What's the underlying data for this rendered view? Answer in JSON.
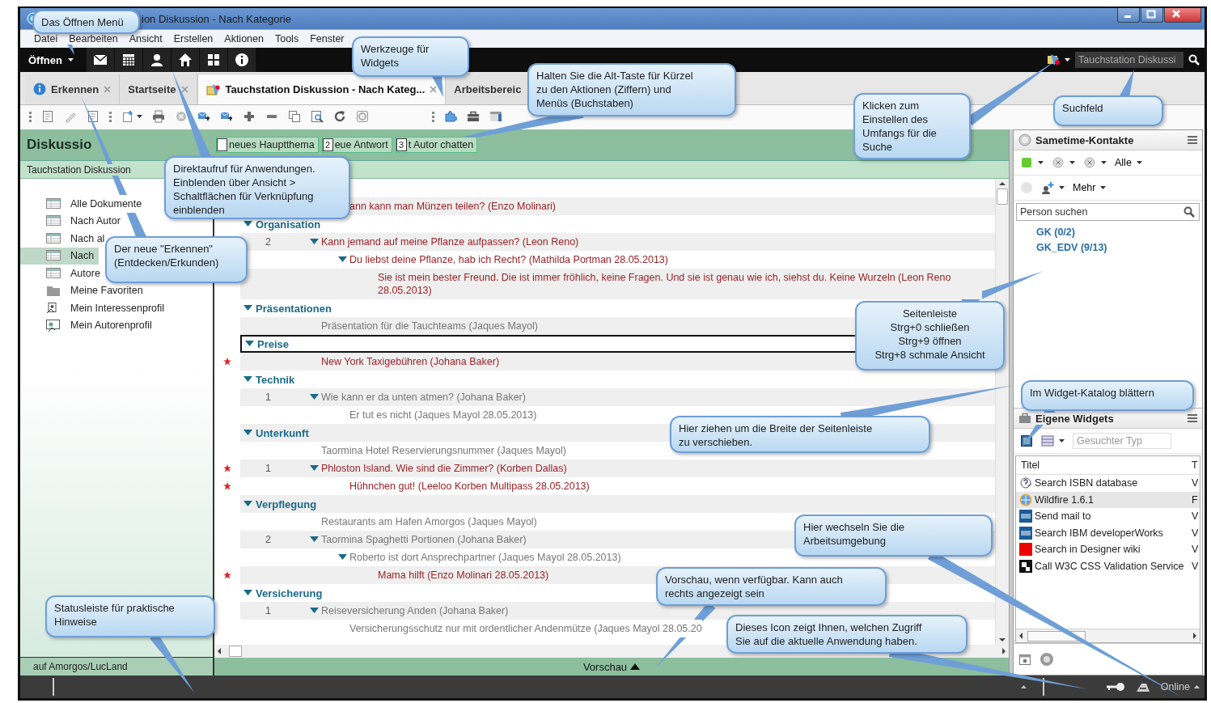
{
  "window": {
    "title": "ion Diskussion - Nach Kategorie"
  },
  "menu": [
    "Datei",
    "Bearbeiten",
    "Ansicht",
    "Erstellen",
    "Aktionen",
    "Tools",
    "Fenster"
  ],
  "launcher": {
    "open_label": "Öffnen",
    "search": {
      "placeholder": "Tauchstation Diskussi"
    }
  },
  "tabs": [
    {
      "label": "Erkennen",
      "selected": false,
      "closable": true,
      "kind": "info"
    },
    {
      "label": "Startseite",
      "selected": false,
      "closable": true,
      "kind": "plain"
    },
    {
      "label": "Tauchstation Diskussion - Nach Kateg...",
      "selected": true,
      "closable": true,
      "kind": "app"
    },
    {
      "label": "Arbeitsbereic",
      "selected": false,
      "closable": false,
      "kind": "plain"
    }
  ],
  "view": {
    "title": "Diskussio",
    "database": "Tauchstation Diskussion",
    "actions": [
      {
        "label": "neues Hauptthema"
      },
      {
        "key": "2",
        "label": "eue Antwort"
      },
      {
        "key": "3",
        "label": "t Autor chatten"
      }
    ]
  },
  "navigation": [
    {
      "label": "Alle Dokumente",
      "kind": "view",
      "selected": false
    },
    {
      "label": "Nach Autor",
      "kind": "view",
      "selected": false
    },
    {
      "label": "Nach al",
      "kind": "view",
      "selected": false
    },
    {
      "label": "Nach",
      "kind": "view",
      "selected": true
    },
    {
      "label": "Autore",
      "kind": "view",
      "selected": false
    },
    {
      "label": "Meine Favoriten",
      "kind": "folder",
      "selected": false
    },
    {
      "label": "Mein Interessenprofil",
      "kind": "profile",
      "selected": false
    },
    {
      "label": "Mein Autorenprofil",
      "kind": "author",
      "selected": false
    }
  ],
  "server": "auf Amorgos/LucLand",
  "rows": [
    {
      "kind": "entry",
      "label": "ann kann man Münzen teilen? (Enzo Molinari)",
      "unread": true
    },
    {
      "kind": "category",
      "label": "Organisation",
      "selected": false,
      "expanded": true,
      "children": [
        {
          "kind": "entry",
          "count": "2",
          "label": "Kann jemand auf meine Pflanze aufpassen? (Leon Reno)",
          "unread": true,
          "starred": false,
          "expanded": true,
          "children": [
            {
              "kind": "entry",
              "label": "Du liebst deine Pflanze, hab ich Recht?  (Mathilda Portman 28.05.2013)",
              "unread": true,
              "starred": false,
              "expanded": true,
              "children": [
                {
                  "kind": "entry",
                  "label": "Sie ist mein bester Freund. Die ist immer fröhlich, keine Fragen. Und sie ist genau wie ich, siehst du. Keine Wurzeln  (Leon Reno 28.05.2013)",
                  "unread": true,
                  "starred": false
                }
              ]
            }
          ]
        }
      ]
    },
    {
      "kind": "category",
      "label": "Präsentationen",
      "selected": false,
      "expanded": true,
      "children": [
        {
          "kind": "entry",
          "label": "Präsentation für die Tauchteams (Jaques Mayol)",
          "unread": false,
          "starred": false
        }
      ]
    },
    {
      "kind": "category",
      "label": "Preise",
      "selected": true,
      "expanded": true,
      "children": [
        {
          "kind": "entry",
          "label": "New York Taxigebühren (Johana Baker)",
          "unread": true,
          "starred": true
        }
      ]
    },
    {
      "kind": "category",
      "label": "Technik",
      "selected": false,
      "expanded": true,
      "children": [
        {
          "kind": "entry",
          "count": "1",
          "label": "Wie kann er da unten atmen? (Johana Baker)",
          "unread": false,
          "starred": false,
          "expanded": true,
          "children": [
            {
              "kind": "entry",
              "label": "Er tut es nicht  (Jaques Mayol 28.05.2013)",
              "unread": false,
              "starred": false
            }
          ]
        }
      ]
    },
    {
      "kind": "category",
      "label": "Unterkunft",
      "selected": false,
      "expanded": true,
      "children": [
        {
          "kind": "entry",
          "label": "Taormina Hotel Reservierungsnummer (Jaques Mayol)",
          "unread": false,
          "starred": false
        },
        {
          "kind": "entry",
          "count": "1",
          "label": "Phloston Island. Wie sind die Zimmer? (Korben Dallas)",
          "unread": true,
          "starred": true,
          "expanded": true,
          "children": [
            {
              "kind": "entry",
              "label": "Hühnchen gut!  (Leeloo Korben Multipass 28.05.2013)",
              "unread": true,
              "starred": true
            }
          ]
        }
      ]
    },
    {
      "kind": "category",
      "label": "Verpflegung",
      "selected": false,
      "expanded": true,
      "children": [
        {
          "kind": "entry",
          "label": "Restaurants am Hafen Amorgos (Jaques Mayol)",
          "unread": false,
          "starred": false
        },
        {
          "kind": "entry",
          "count": "2",
          "label": "Taormina Spaghetti Portionen (Johana Baker)",
          "unread": false,
          "starred": false,
          "expanded": true,
          "children": [
            {
              "kind": "entry",
              "label": "Roberto ist dort Ansprechpartner  (Jaques Mayol 28.05.2013)",
              "unread": false,
              "starred": false,
              "expanded": true,
              "children": [
                {
                  "kind": "entry",
                  "label": "Mama hilft  (Enzo Molinari 28.05.2013)",
                  "unread": true,
                  "starred": true
                }
              ]
            }
          ]
        }
      ]
    },
    {
      "kind": "category",
      "label": "Versicherung",
      "selected": false,
      "expanded": true,
      "children": [
        {
          "kind": "entry",
          "count": "1",
          "label": "Reiseversicherung Anden (Johana Baker)",
          "unread": false,
          "starred": false,
          "expanded": true,
          "children": [
            {
              "kind": "entry",
              "label": "Versicherungsschutz nur mit ordentlicher Andenmütze  (Jaques Mayol 28.05.20",
              "unread": false,
              "starred": false
            }
          ]
        }
      ]
    }
  ],
  "preview": {
    "label": "Vorschau"
  },
  "sidebar": {
    "contacts": {
      "title": "Sametime-Kontakte",
      "filter": "Alle",
      "more": "Mehr",
      "search": {
        "placeholder": "Person suchen"
      },
      "groups": [
        "GK (0/2)",
        "GK_EDV (9/13)"
      ]
    },
    "widgets": {
      "title": "Eigene Widgets",
      "search": {
        "placeholder": "Gesuchter Typ"
      },
      "columns": [
        "Titel",
        "T"
      ],
      "rows": [
        {
          "title": "Search ISBN database",
          "column_2": "V",
          "kind": "question",
          "selected": false
        },
        {
          "title": "Wildfire 1.6.1",
          "column_2": "F",
          "kind": "globe",
          "selected": true
        },
        {
          "title": "Send mail to",
          "column_2": "V",
          "kind": "ibm",
          "selected": false
        },
        {
          "title": "Search IBM developerWorks",
          "column_2": "V",
          "kind": "ibm",
          "selected": false
        },
        {
          "title": "Search in Designer wiki",
          "column_2": "V",
          "kind": "red",
          "selected": false
        },
        {
          "title": "Call W3C CSS Validation Service",
          "column_2": "V",
          "kind": "w3c",
          "selected": false
        }
      ]
    }
  },
  "status_bar": {
    "online": "Online"
  },
  "callouts": [
    {
      "text": "Das Öffnen Menü"
    },
    {
      "text": "Werkzeuge für\nWidgets"
    },
    {
      "text": "Halten Sie die Alt-Taste für Kürzel\nzu den Aktionen (Ziffern) und\nMenüs (Buchstaben)"
    },
    {
      "text": "Direktaufruf für Anwendungen.\nEinblenden über Ansicht >\nSchaltflächen für Verknüpfung\neinblenden"
    },
    {
      "text": "Der neue \"Erkennen\"\n(Entdecken/Erkunden)"
    },
    {
      "text": "Klicken zum\nEinstellen des\nUmfangs für die\nSuche"
    },
    {
      "text": "Suchfeld"
    },
    {
      "text": "Seitenleiste\nStrg+0 schließen\nStrg+9 öffnen\nStrg+8 schmale Ansicht",
      "centered": true
    },
    {
      "text": "Im Widget-Katalog blättern"
    },
    {
      "text": "Hier ziehen um die Breite der Seitenleiste\nzu verschieben."
    },
    {
      "text": "Hier wechseln Sie die\nArbeitsumgebung"
    },
    {
      "text": "Vorschau, wenn verfügbar. Kann auch\nrechts angezeigt sein"
    },
    {
      "text": "Dieses Icon zeigt Ihnen, welchen Zugriff\nSie auf die aktuelle Anwendung haben."
    },
    {
      "text": "Statusleiste für praktische\nHinweise"
    }
  ]
}
